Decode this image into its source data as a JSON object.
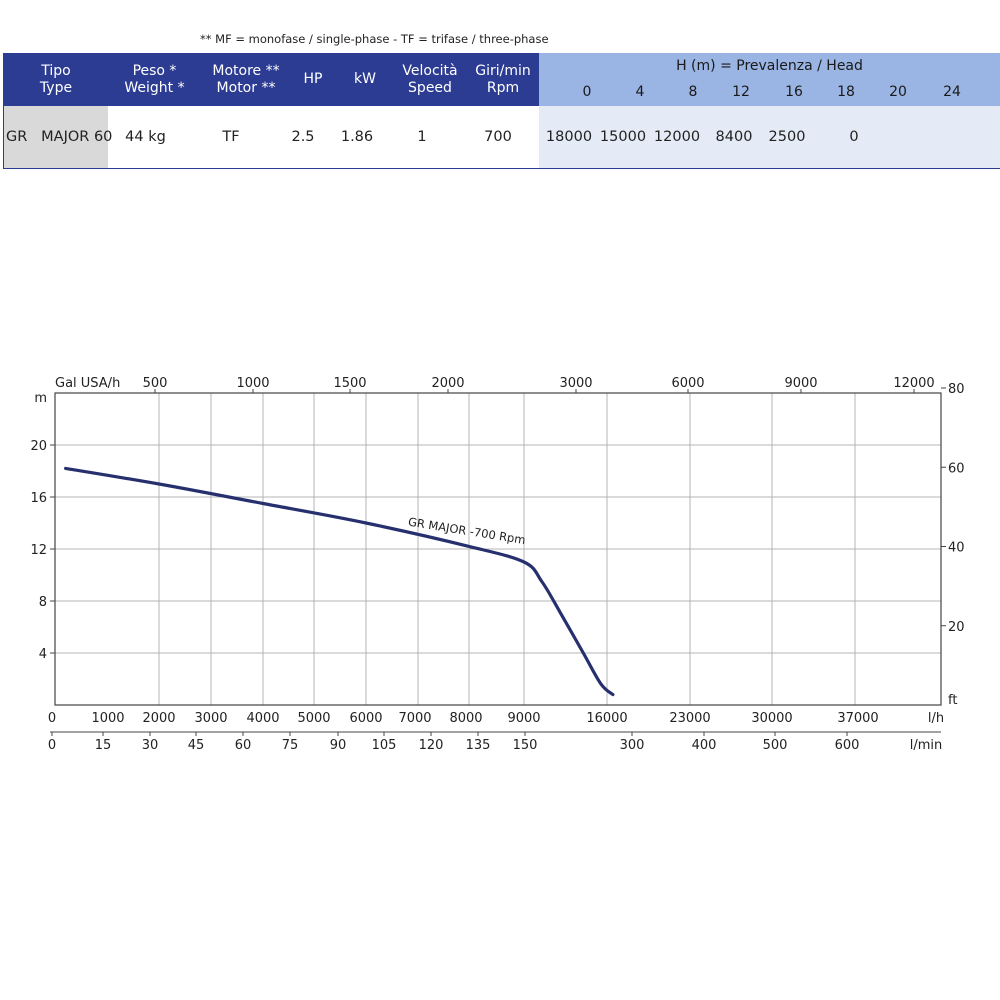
{
  "note": "** MF =  monofase / single-phase - TF =  trifase / three-phase",
  "table": {
    "headers": {
      "type": [
        "Tipo",
        "Type"
      ],
      "weight": [
        "Peso  *",
        "Weight *"
      ],
      "motor": [
        "Motore **",
        "Motor **"
      ],
      "hp": "HP",
      "kw": "kW",
      "speed": [
        "Velocità",
        "Speed"
      ],
      "rpm": [
        "Giri/min",
        "Rpm"
      ],
      "head_title": "H (m) =  Prevalenza / Head",
      "head_cols": [
        "0",
        "4",
        "8",
        "12",
        "16",
        "18",
        "20",
        "24"
      ]
    },
    "row": {
      "type": "GR   MAJOR 60",
      "weight": "44 kg",
      "motor": "TF",
      "hp": "2.5",
      "kw": "1.86",
      "speed": "1",
      "rpm": "700",
      "flows": [
        "18000",
        "15000",
        "12000",
        "8400",
        "2500",
        "0",
        "",
        ""
      ]
    }
  },
  "chart_data": {
    "type": "line",
    "title": "",
    "curve_label": "GR MAJOR  -700 Rpm",
    "ylabel_left": "m",
    "ylabel_right": "ft",
    "ylim": [
      0,
      24
    ],
    "yticks_left": [
      "4",
      "8",
      "12",
      "16",
      "20"
    ],
    "yticks_right": [
      "20",
      "40",
      "60",
      "80"
    ],
    "x_top_label": "Gal USA/h",
    "x_top_ticks": [
      "500",
      "1000",
      "1500",
      "2000",
      "3000",
      "6000",
      "9000",
      "12000"
    ],
    "x_lh_label": "l/h",
    "x_lh_ticks": [
      "0",
      "1000",
      "2000",
      "3000",
      "4000",
      "5000",
      "6000",
      "7000",
      "8000",
      "9000",
      "16000",
      "23000",
      "30000",
      "37000"
    ],
    "x_lmin_label": "l/min",
    "x_lmin_ticks": [
      "0",
      "15",
      "30",
      "45",
      "60",
      "75",
      "90",
      "105",
      "120",
      "135",
      "150",
      "300",
      "400",
      "500",
      "600"
    ],
    "series": [
      {
        "x_lh": [
          200,
          2000,
          4000,
          6000,
          8000,
          9000,
          10500,
          12000,
          14000,
          15500,
          16500
        ],
        "y_m": [
          18.2,
          17.0,
          15.5,
          14.0,
          12.2,
          11.0,
          9.5,
          7.2,
          4.0,
          1.6,
          0.8
        ]
      }
    ]
  }
}
